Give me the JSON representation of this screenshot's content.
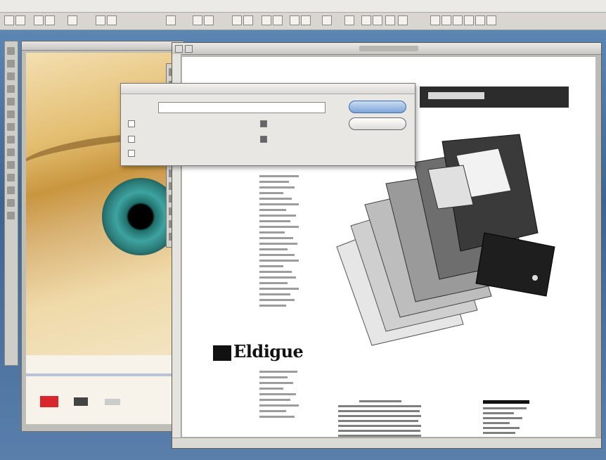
{
  "menubar": {
    "apple": "",
    "app_name": "",
    "items": [
      "",
      "",
      "",
      "",
      "",
      "",
      "",
      "",
      ""
    ],
    "clock": ""
  },
  "dialog": {
    "title": "",
    "find_label": "",
    "find_value": "",
    "options_left": [
      "",
      "",
      ""
    ],
    "options_right": [
      "",
      ""
    ],
    "option_states_left": [
      false,
      false,
      false
    ],
    "option_states_right": [
      true,
      true
    ],
    "primary_button": "",
    "secondary_button": ""
  },
  "page": {
    "logo_text": "Eldigue"
  },
  "colors": {
    "desktop": "#4a6f9a",
    "logo_red": "#d9262c",
    "primary_button": "#7ea5d6"
  },
  "icons": {
    "toolbox": "tools-palette-icon",
    "palette": "swatch-palette-icon"
  }
}
